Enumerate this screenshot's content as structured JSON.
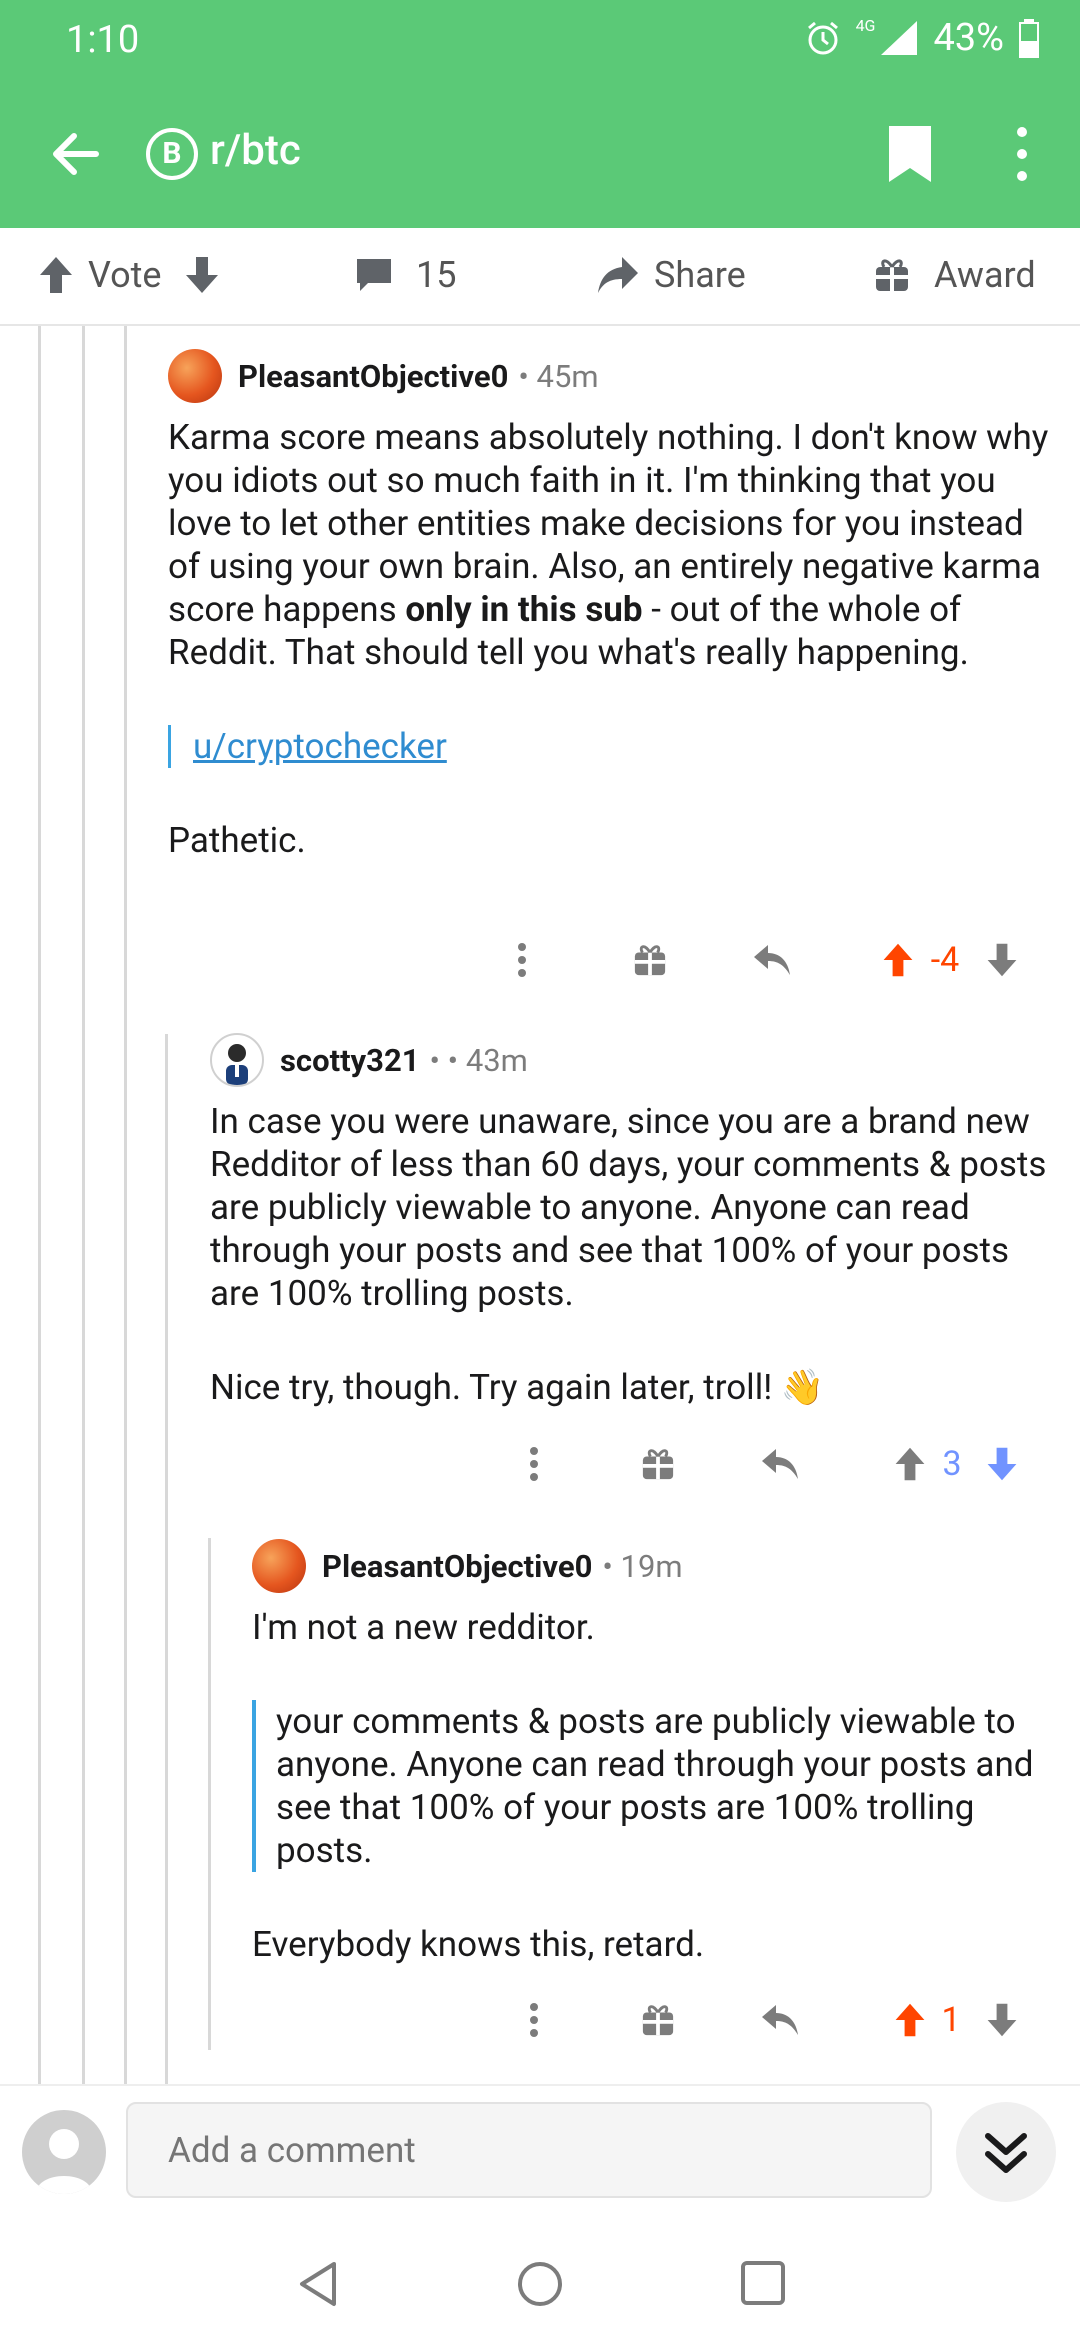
{
  "status_bar": {
    "time": "1:10",
    "network": "4G",
    "battery": "43%"
  },
  "app_bar": {
    "subreddit": "r/btc",
    "sub_icon_glyph": "B"
  },
  "action_bar": {
    "vote_label": "Vote",
    "comment_count": "15",
    "share_label": "Share",
    "award_label": "Award"
  },
  "comments": [
    {
      "user": "PleasantObjective0",
      "meta": "• 45m",
      "body_before_bold": "Karma score means absolutely nothing.  I don't know why you idiots out so much faith in it.  I'm thinking that you love to let other entities make decisions for you instead of using your own brain.  Also, an entirely negative karma score happens ",
      "body_bold": "only in this sub",
      "body_after_bold": " - out of the whole of Reddit.  That should tell you what's really happening.",
      "quote_link": "u/cryptochecker",
      "closing": "Pathetic.",
      "score": "-4"
    },
    {
      "user": "scotty321",
      "meta": "• • 43m",
      "body": "In case you were unaware, since you are a brand new Redditor of less than 60 days, your comments & posts are publicly viewable to anyone. Anyone can read through your posts and see that 100% of your posts are 100% trolling posts.",
      "closing": "Nice try, though. Try again later, troll!",
      "emoji": "👋",
      "score": "3"
    },
    {
      "user": "PleasantObjective0",
      "meta": "• 19m",
      "body": "I'm not a new redditor.",
      "quote": "your comments & posts are publicly viewable to anyone. Anyone can read through your posts and see that 100% of your posts are 100% trolling posts.",
      "closing": "Everybody knows this, retard.",
      "score": "1"
    }
  ],
  "bottom_bar": {
    "placeholder": "Add a comment"
  },
  "colors": {
    "header": "#5bc977",
    "upvote": "#ff4500",
    "downvote": "#7193ff",
    "quote_bar": "#3aa4e2"
  }
}
